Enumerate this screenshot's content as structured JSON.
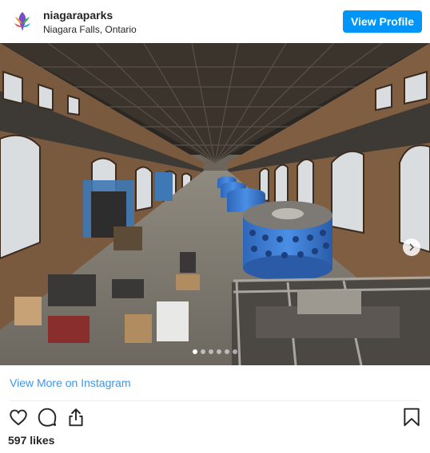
{
  "post": {
    "account_name": "niagaraparks",
    "location": "Niagara Falls, Ontario",
    "view_profile_label": "View Profile",
    "image_alt": "Interior of historic power station with blue generators",
    "view_more_label": "View More on Instagram",
    "likes_text": "597 likes",
    "carousel": {
      "slide_count": 6,
      "active_index": 0
    }
  },
  "icons": {
    "avatar": "niagara-parks-logo",
    "next": "chevron-right-icon",
    "like": "heart-icon",
    "comment": "comment-icon",
    "share": "share-icon",
    "save": "bookmark-icon"
  },
  "colors": {
    "accent": "#0095f6",
    "link": "#3897f0",
    "text": "#262626",
    "generator": "#3f7fd6"
  }
}
